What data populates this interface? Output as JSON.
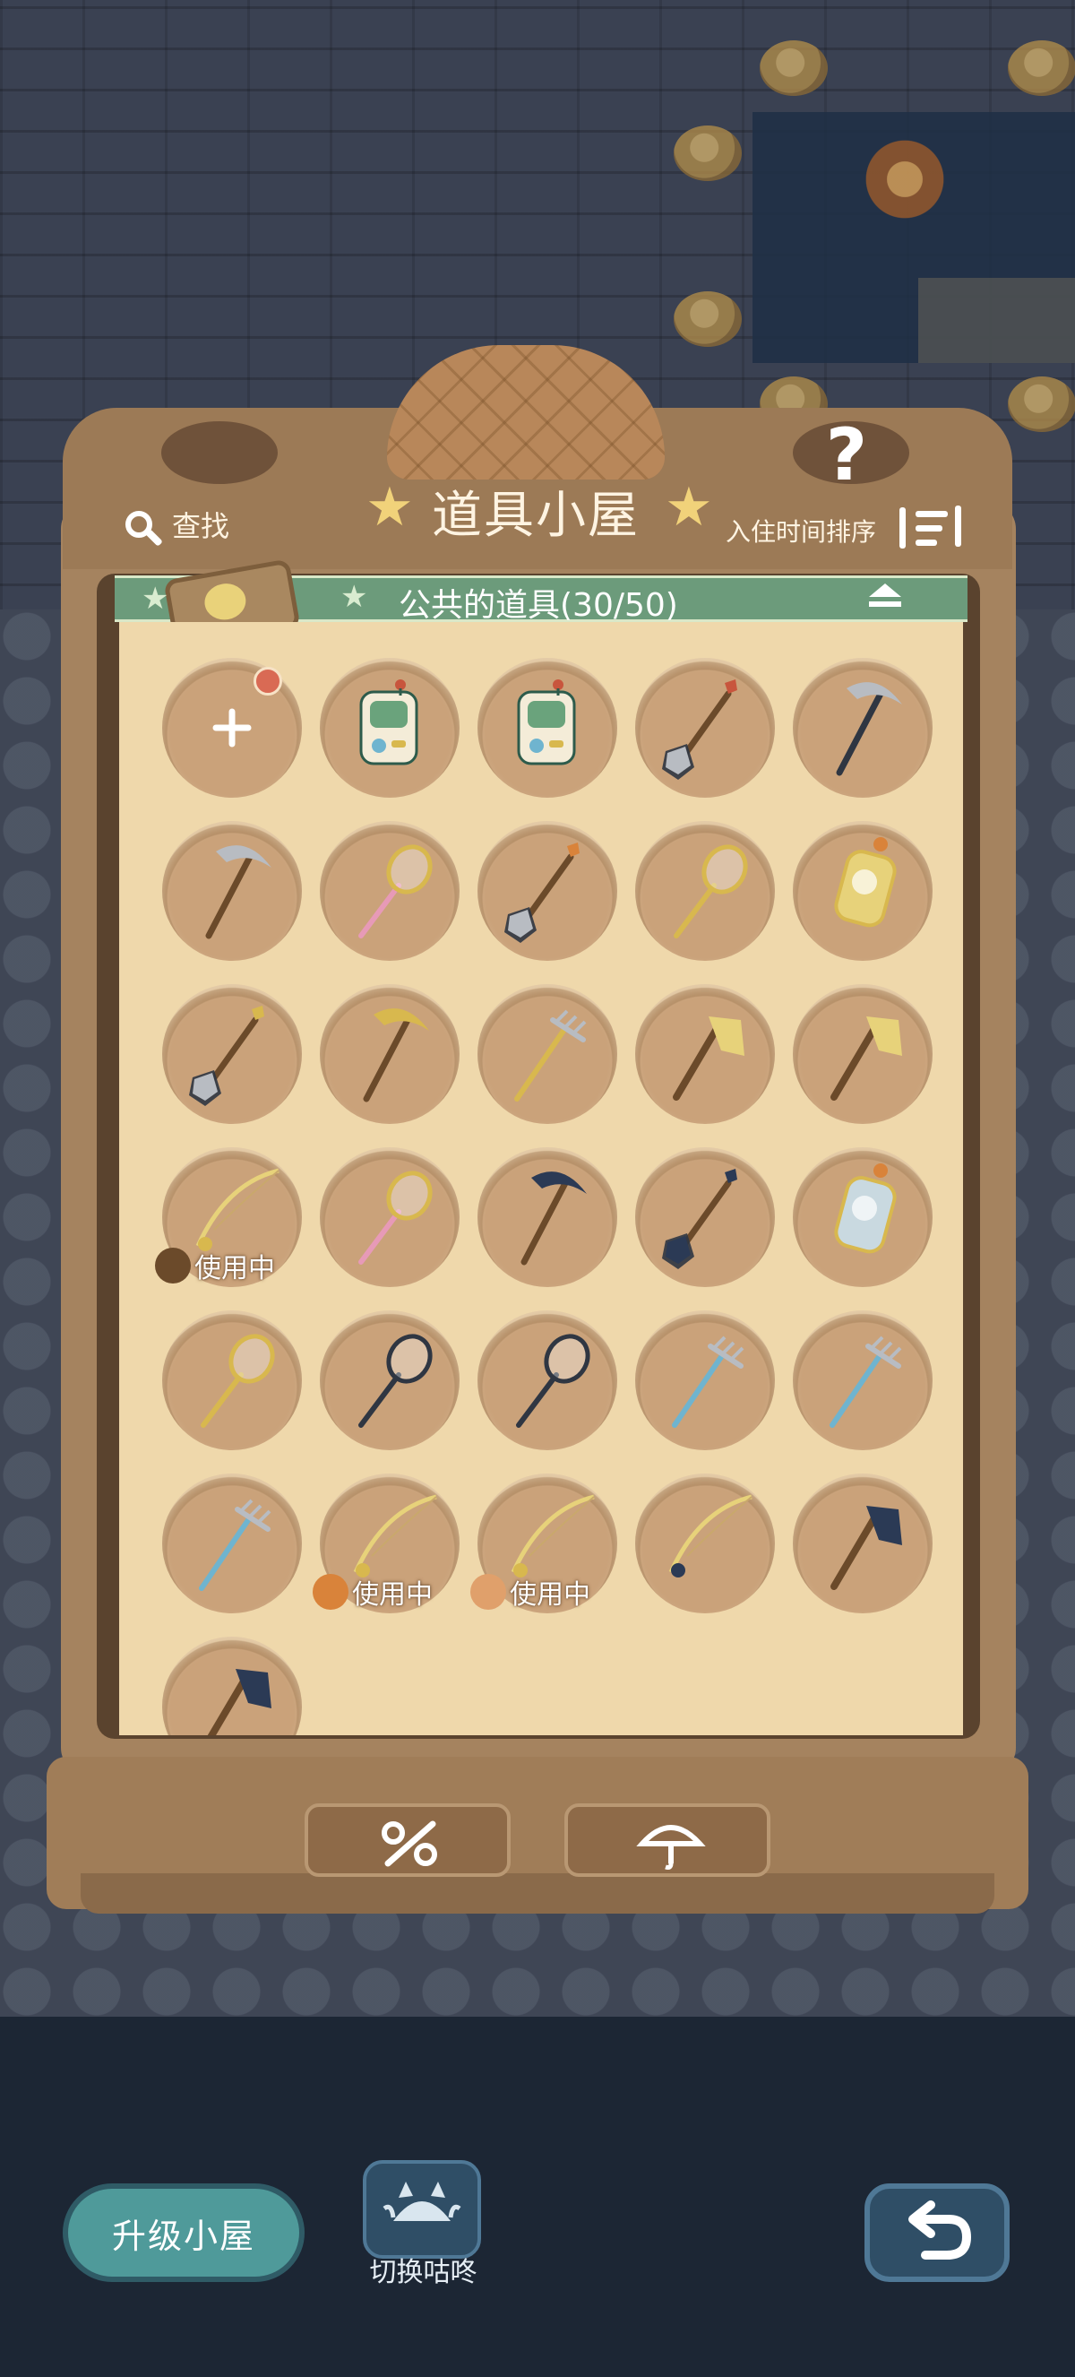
{
  "header": {
    "title": "道具小屋",
    "search_label": "查找",
    "sort_label": "入住时间排序",
    "help_label": "?"
  },
  "banner": {
    "title": "公共的道具(30/50)"
  },
  "slots": [
    {
      "item": "add-slot",
      "label": "+",
      "has_dot": true
    },
    {
      "item": "timer-device"
    },
    {
      "item": "timer-device"
    },
    {
      "item": "shovel-red"
    },
    {
      "item": "pickaxe-dark"
    },
    {
      "item": "pickaxe-silver"
    },
    {
      "item": "bug-net-pink"
    },
    {
      "item": "shovel-orange"
    },
    {
      "item": "bug-net-yellow"
    },
    {
      "item": "charm-green"
    },
    {
      "item": "shovel-gold"
    },
    {
      "item": "pickaxe-gold"
    },
    {
      "item": "rake-gold"
    },
    {
      "item": "axe-gold"
    },
    {
      "item": "axe-gold"
    },
    {
      "item": "fishing-rod",
      "in_use": "使用中",
      "user": "deer"
    },
    {
      "item": "bug-net-pink"
    },
    {
      "item": "pickaxe-navy"
    },
    {
      "item": "shovel-navy"
    },
    {
      "item": "charm-cute"
    },
    {
      "item": "bug-net-yellow"
    },
    {
      "item": "bug-net-black"
    },
    {
      "item": "bug-net-black"
    },
    {
      "item": "rake-blue"
    },
    {
      "item": "rake-blue"
    },
    {
      "item": "rake-blue"
    },
    {
      "item": "fishing-rod",
      "in_use": "使用中",
      "user": "squirrel"
    },
    {
      "item": "fishing-rod",
      "in_use": "使用中",
      "user": "fox"
    },
    {
      "item": "fishing-rod-blue"
    },
    {
      "item": "axe-navy"
    },
    {
      "item": "axe-navy"
    }
  ],
  "cabinet_buttons": [
    {
      "name": "discount-icon"
    },
    {
      "name": "umbrella-icon"
    }
  ],
  "footer": {
    "upgrade_label": "升级小屋",
    "switch_label": "切换咕咚"
  },
  "colors": {
    "banner": "#6c9b7b",
    "paper": "#efd8ab",
    "cabinet": "#a5835f",
    "upgrade_button": "#4f9a9a"
  }
}
